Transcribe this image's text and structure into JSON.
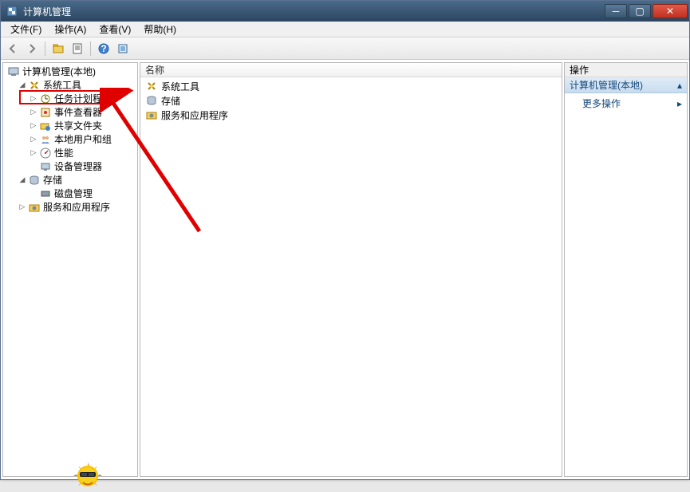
{
  "window": {
    "title": "计算机管理",
    "controls": {
      "min": "－",
      "max": "▢",
      "close": "✕"
    }
  },
  "menus": [
    {
      "label": "文件(F)"
    },
    {
      "label": "操作(A)"
    },
    {
      "label": "查看(V)"
    },
    {
      "label": "帮助(H)"
    }
  ],
  "toolbar_icons": [
    "nav-back-icon",
    "nav-forward-icon",
    "sep",
    "folder-up-icon",
    "properties-icon",
    "sep",
    "help-icon",
    "refresh-icon"
  ],
  "tree": {
    "root": {
      "label": "计算机管理(本地)",
      "children": [
        {
          "label": "系统工具",
          "expanded": true,
          "children": [
            {
              "label": "任务计划程序",
              "highlight": true
            },
            {
              "label": "事件查看器"
            },
            {
              "label": "共享文件夹"
            },
            {
              "label": "本地用户和组"
            },
            {
              "label": "性能"
            },
            {
              "label": "设备管理器"
            }
          ]
        },
        {
          "label": "存储",
          "expanded": true,
          "children": [
            {
              "label": "磁盘管理"
            }
          ]
        },
        {
          "label": "服务和应用程序"
        }
      ]
    }
  },
  "content": {
    "column_header": "名称",
    "rows": [
      {
        "label": "系统工具",
        "icon": "tools-icon"
      },
      {
        "label": "存储",
        "icon": "storage-icon"
      },
      {
        "label": "服务和应用程序",
        "icon": "services-icon"
      }
    ]
  },
  "actions": {
    "panel_title": "操作",
    "group_header": "计算机管理(本地)",
    "items": [
      {
        "label": "更多操作",
        "has_submenu": true
      }
    ]
  }
}
